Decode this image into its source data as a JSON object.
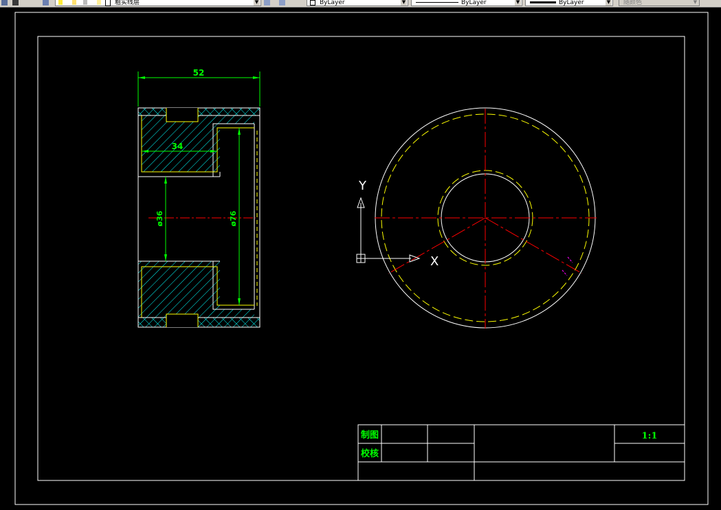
{
  "toolbar": {
    "layer_name": "粗实线层",
    "color": "ByLayer",
    "linetype": "ByLayer",
    "lineweight": "ByLayer",
    "plotstyle": "随颜色"
  },
  "drawing": {
    "dimensions": {
      "width_52": "52",
      "width_34": "34",
      "dia_36": "ø36",
      "dia_76": "ø76"
    },
    "ucs": {
      "x_label": "X",
      "y_label": "Y"
    },
    "title_block": {
      "drawn_by_label": "制图",
      "checked_by_label": "校核",
      "scale": "1:1"
    }
  },
  "colors": {
    "background": "#000000",
    "border": "#ffffff",
    "dimension": "#00ff00",
    "hatch": "#00ffff",
    "hidden": "#ffff00",
    "center": "#ff0000",
    "magenta": "#ff00ff"
  }
}
